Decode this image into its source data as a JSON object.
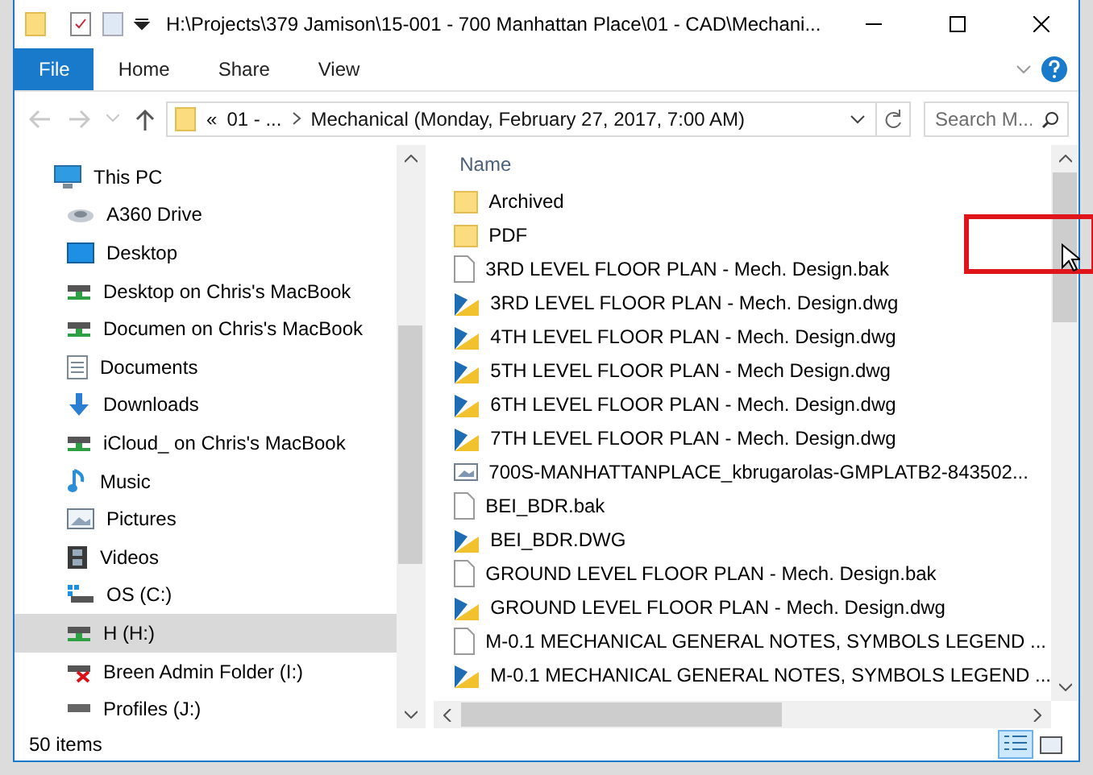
{
  "window": {
    "title": "H:\\Projects\\379 Jamison\\15-001 - 700 Manhattan Place\\01 - CAD\\Mechani..."
  },
  "ribbon_tabs": [
    {
      "label": "File",
      "kind": "file"
    },
    {
      "label": "Home",
      "kind": "tab"
    },
    {
      "label": "Share",
      "kind": "tab"
    },
    {
      "label": "View",
      "kind": "tab"
    }
  ],
  "address": {
    "overflow": "«",
    "path": [
      "01 - ...",
      "Mechanical (Monday, February 27, 2017, 7:00 AM)"
    ]
  },
  "search": {
    "placeholder": "Search M..."
  },
  "nav_pane": {
    "items": [
      {
        "label": "This PC",
        "kind": "pc",
        "selected": false
      },
      {
        "label": "A360 Drive",
        "kind": "cloud",
        "selected": false
      },
      {
        "label": "Desktop",
        "kind": "desktop",
        "selected": false
      },
      {
        "label": "Desktop on Chris's MacBook",
        "kind": "netdrive",
        "selected": false
      },
      {
        "label": "Documen on Chris's MacBook",
        "kind": "netdrive",
        "selected": false
      },
      {
        "label": "Documents",
        "kind": "documents",
        "selected": false
      },
      {
        "label": "Downloads",
        "kind": "downloads",
        "selected": false
      },
      {
        "label": "iCloud_ on Chris's MacBook",
        "kind": "netdrive",
        "selected": false
      },
      {
        "label": "Music",
        "kind": "music",
        "selected": false
      },
      {
        "label": "Pictures",
        "kind": "pictures",
        "selected": false
      },
      {
        "label": "Videos",
        "kind": "videos",
        "selected": false
      },
      {
        "label": "OS (C:)",
        "kind": "osdrive",
        "selected": false
      },
      {
        "label": "H (H:)",
        "kind": "netdrive",
        "selected": true
      },
      {
        "label": "Breen Admin Folder (I:)",
        "kind": "baddrive",
        "selected": false
      },
      {
        "label": "Profiles (J:)",
        "kind": "drive",
        "selected": false
      }
    ]
  },
  "file_list": {
    "column": "Name",
    "files": [
      {
        "name": "Archived",
        "kind": "folder"
      },
      {
        "name": "PDF",
        "kind": "folder"
      },
      {
        "name": "3RD LEVEL FLOOR PLAN - Mech. Design.bak",
        "kind": "blank"
      },
      {
        "name": "3RD LEVEL FLOOR PLAN - Mech. Design.dwg",
        "kind": "dwg"
      },
      {
        "name": "4TH LEVEL FLOOR PLAN - Mech. Design.dwg",
        "kind": "dwg"
      },
      {
        "name": "5TH LEVEL FLOOR PLAN - Mech Design.dwg",
        "kind": "dwg"
      },
      {
        "name": "6TH LEVEL FLOOR PLAN - Mech. Design.dwg",
        "kind": "dwg"
      },
      {
        "name": "7TH LEVEL FLOOR PLAN - Mech. Design.dwg",
        "kind": "dwg"
      },
      {
        "name": "700S-MANHATTANPLACE_kbrugarolas-GMPLATB2-843502...",
        "kind": "image"
      },
      {
        "name": "BEI_BDR.bak",
        "kind": "blank"
      },
      {
        "name": "BEI_BDR.DWG",
        "kind": "dwg"
      },
      {
        "name": "GROUND LEVEL FLOOR PLAN - Mech. Design.bak",
        "kind": "blank"
      },
      {
        "name": "GROUND LEVEL FLOOR PLAN - Mech. Design.dwg",
        "kind": "dwg"
      },
      {
        "name": "M-0.1 MECHANICAL GENERAL NOTES, SYMBOLS LEGEND ...",
        "kind": "blank"
      },
      {
        "name": "M-0.1 MECHANICAL GENERAL NOTES, SYMBOLS LEGEND ...",
        "kind": "dwg"
      }
    ]
  },
  "status_bar": {
    "count": "50 items"
  }
}
